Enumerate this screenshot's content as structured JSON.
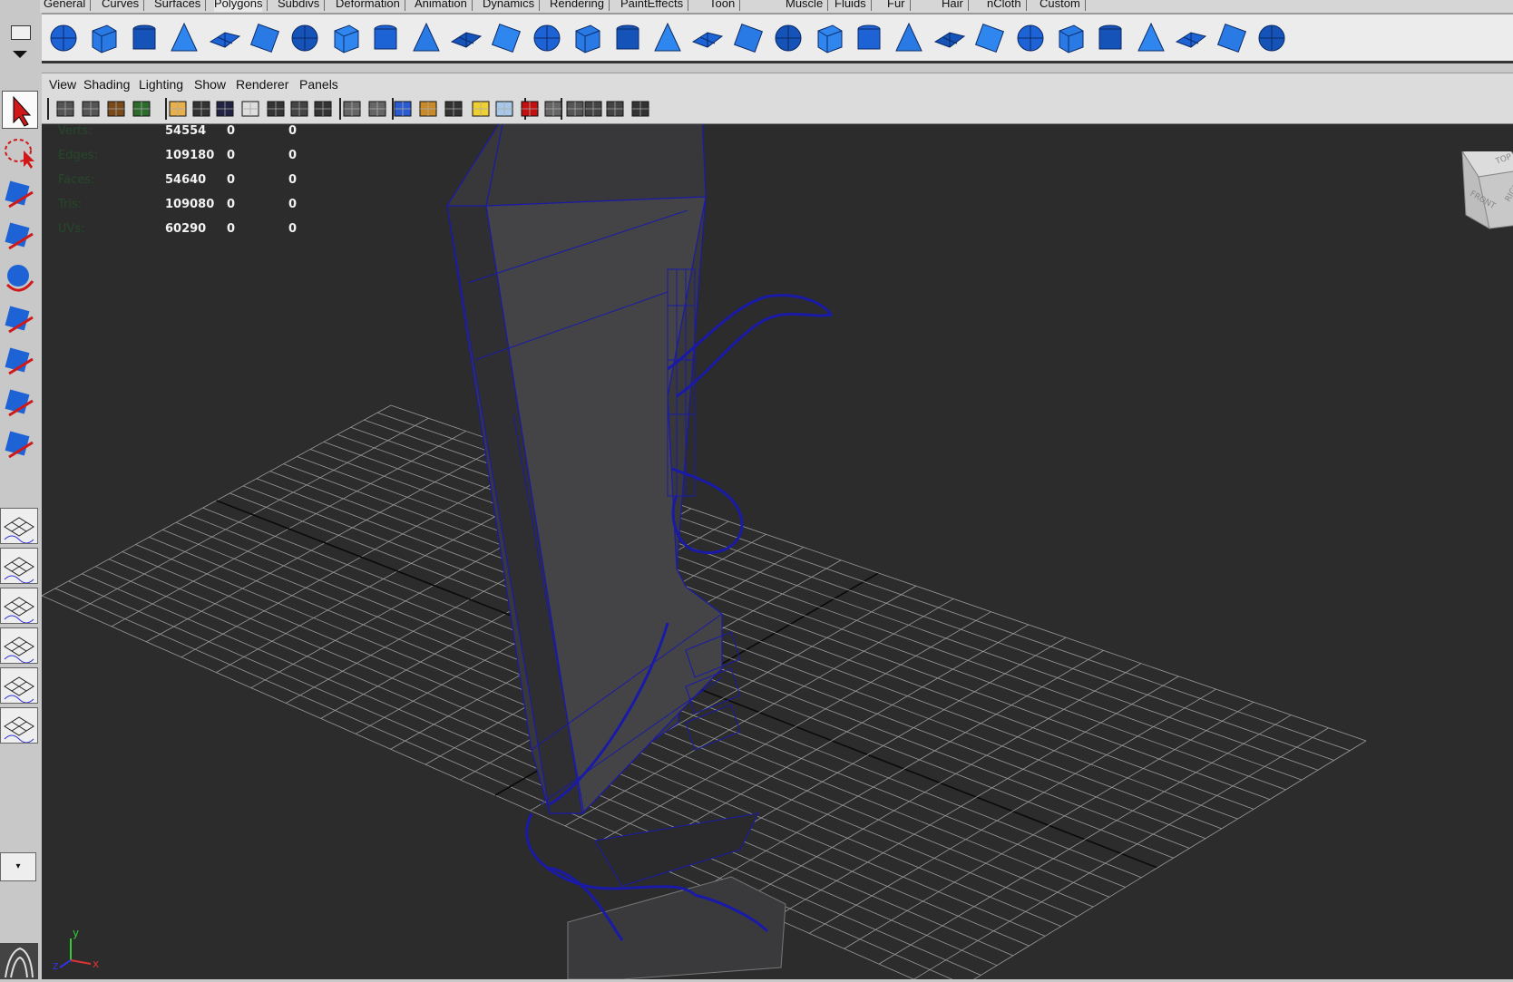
{
  "shelf_tabs": [
    {
      "label": "General",
      "active": false
    },
    {
      "label": "Curves",
      "active": false
    },
    {
      "label": "Surfaces",
      "active": false
    },
    {
      "label": "Polygons",
      "active": true
    },
    {
      "label": "Subdivs",
      "active": false
    },
    {
      "label": "Deformation",
      "active": false
    },
    {
      "label": "Animation",
      "active": false
    },
    {
      "label": "Dynamics",
      "active": false
    },
    {
      "label": "Rendering",
      "active": false
    },
    {
      "label": "PaintEffects",
      "active": false
    },
    {
      "label": "Toon",
      "active": false
    },
    {
      "label": "Muscle",
      "active": false
    },
    {
      "label": "Fluids",
      "active": false
    },
    {
      "label": "Fur",
      "active": false
    },
    {
      "label": "Hair",
      "active": false
    },
    {
      "label": "nCloth",
      "active": false
    },
    {
      "label": "Custom",
      "active": false
    }
  ],
  "shelf_icons": [
    "poly-sphere-icon",
    "poly-cube-icon",
    "poly-cylinder-icon",
    "poly-cone-icon",
    "poly-plane-icon",
    "poly-torus-icon",
    "poly-prism-icon",
    "poly-pipe-icon",
    "poly-helix-icon",
    "combine-icon",
    "separate-icon",
    "poly-booleans-icon",
    "smooth-icon",
    "reduce-icon",
    "mirror-geometry-icon",
    "extrude-icon",
    "bridge-icon",
    "append-polygon-icon",
    "fill-hole-icon",
    "split-polygon-icon",
    "insert-edge-loop-icon",
    "offset-edge-loop-icon",
    "sculpt-geometry-icon",
    "planar-mapping-icon",
    "cylindrical-mapping-icon",
    "spherical-mapping-icon",
    "automatic-mapping-icon",
    "uv-texture-editor-icon",
    "checker-map-icon",
    "layout-uvs-icon",
    "uv-snapshot-icon"
  ],
  "toolbox": {
    "tools": [
      "select-tool-icon",
      "lasso-tool-icon",
      "paint-select-tool-icon",
      "move-tool-icon",
      "rotate-tool-icon",
      "scale-tool-icon",
      "universal-manipulator-icon",
      "soft-modification-icon",
      "show-manipulator-icon"
    ],
    "layouts": [
      "single-perspective-layout-icon",
      "four-view-layout-icon",
      "persp-outliner-layout-icon",
      "persp-graph-layout-icon",
      "hypershade-persp-layout-icon",
      "persp-graph-hypergraph-layout-icon"
    ],
    "dropdown_glyph": "▾"
  },
  "panel_menu": [
    "View",
    "Shading",
    "Lighting",
    "Show",
    "Renderer",
    "Panels"
  ],
  "panel_toolbar_icons": [
    "select-camera-icon",
    "lock-camera-icon",
    "camera-attributes-icon",
    "bookmarks-icon",
    "image-plane-icon",
    "grid-icon",
    "film-gate-icon",
    "resolution-gate-icon",
    "gate-mask-icon",
    "field-chart-icon",
    "safe-action-icon",
    "safe-title-icon",
    "wireframe-icon",
    "smooth-shade-icon",
    "flat-shade-icon",
    "bounding-box-icon",
    "use-default-light-icon",
    "textured-icon",
    "shadows-icon",
    "high-quality-icon",
    "isolate-select-icon",
    "xray-icon",
    "xray-joints-icon",
    "backface-culling-icon"
  ],
  "hud": [
    {
      "label": "Verts:",
      "values": [
        "54554",
        "0",
        "0"
      ]
    },
    {
      "label": "Edges:",
      "values": [
        "109180",
        "0",
        "0"
      ]
    },
    {
      "label": "Faces:",
      "values": [
        "54640",
        "0",
        "0"
      ]
    },
    {
      "label": "Tris:",
      "values": [
        "109080",
        "0",
        "0"
      ]
    },
    {
      "label": "UVs:",
      "values": [
        "60290",
        "0",
        "0"
      ]
    }
  ],
  "viewcube": {
    "top": "TOP",
    "front": "FRONT",
    "right": "RIGHT"
  },
  "axis": {
    "y": "y",
    "z": "z",
    "x": "x"
  },
  "colors": {
    "viewport_bg": "#2c2c2c",
    "grid": "#9a9a9a",
    "wire": "#1a1aa8",
    "mesh_fill": "#3a3a3c",
    "hud_label": "#1f5f26"
  }
}
